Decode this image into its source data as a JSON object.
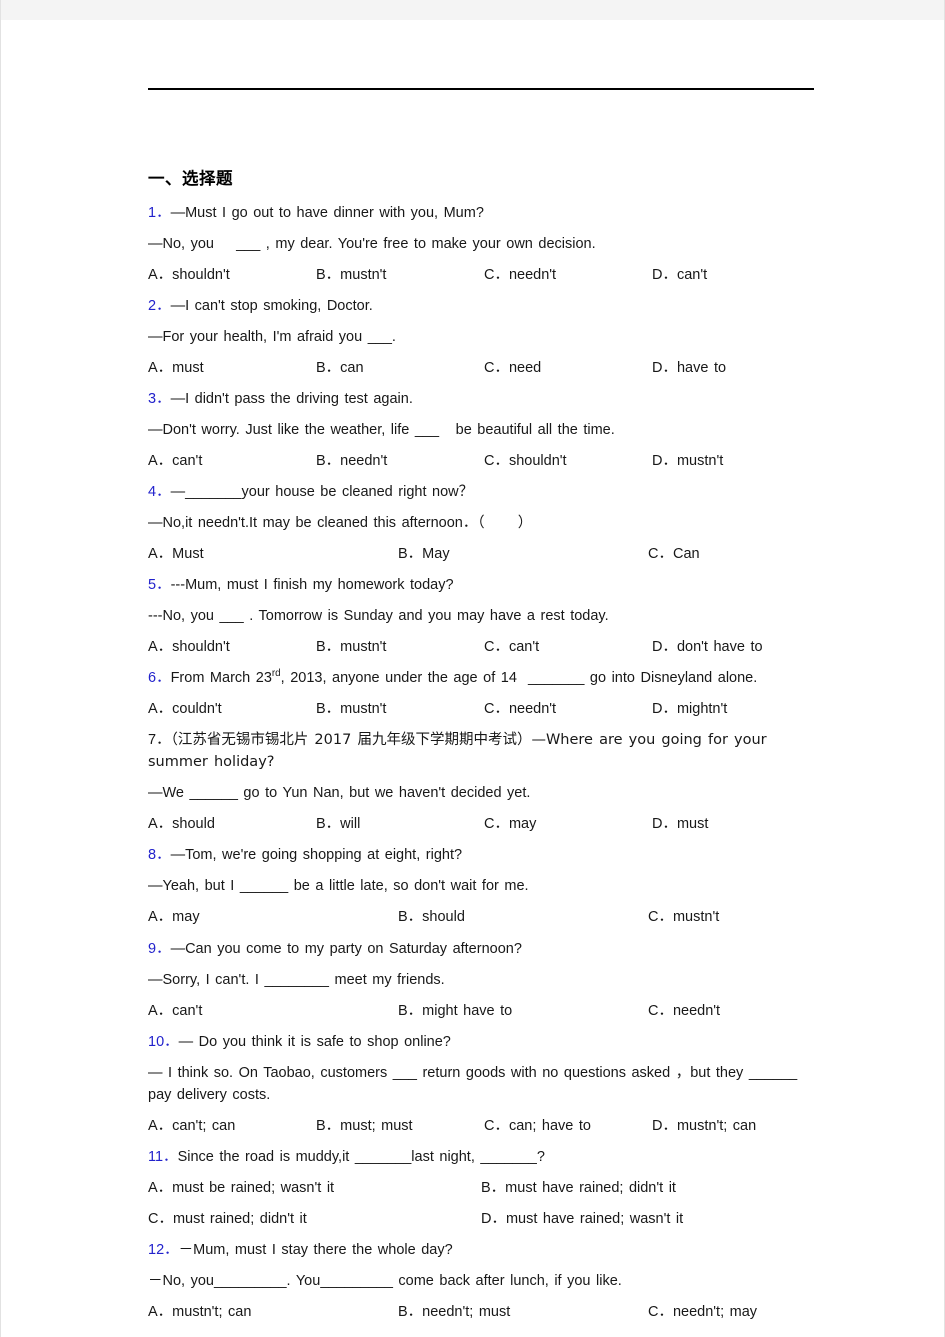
{
  "document": {
    "section_heading": "一、选择题",
    "questions": [
      {
        "number": "1．",
        "lines": [
          "—Must I go out to have dinner with you, Mum?",
          "—No, you    ___ , my dear. You're free to make your own decision."
        ],
        "options": [
          "A．shouldn't",
          "B．mustn't",
          "C．needn't",
          "D．can't"
        ],
        "option_cols": 4
      },
      {
        "number": "2．",
        "lines": [
          "—I can't stop smoking, Doctor.",
          "—For your health, I'm afraid you ___."
        ],
        "options": [
          "A．must",
          "B．can",
          "C．need",
          "D．have to"
        ],
        "option_cols": 4
      },
      {
        "number": "3．",
        "lines": [
          "—I didn't pass the driving test again.",
          "—Don't worry. Just like the weather, life ___   be beautiful all the time."
        ],
        "options": [
          "A．can't",
          "B．needn't",
          "C．shouldn't",
          "D．mustn't"
        ],
        "option_cols": 4
      },
      {
        "number": "4．",
        "lines": [
          "—_______your house be cleaned right now？",
          "—No,it needn't.It may be cleaned this afternoon．（      ）"
        ],
        "options": [
          "A．Must",
          "B．May",
          "C．Can"
        ],
        "option_cols": 3
      },
      {
        "number": "5．",
        "lines": [
          "---Mum, must I finish my homework today?",
          "---No, you ___ . Tomorrow is Sunday and you may have a rest today."
        ],
        "options": [
          "A．shouldn't",
          "B．mustn't",
          "C．can't",
          "D．don't have to"
        ],
        "option_cols": 4
      },
      {
        "number": "6．",
        "lines": [
          "From March 23rd, 2013, anyone under the age of 14  _______ go into Disneyland alone."
        ],
        "superscript_line": true,
        "options": [
          "A．couldn't",
          "B．mustn't",
          "C．needn't",
          "D．mightn't"
        ],
        "option_cols": 4
      },
      {
        "number": "7．",
        "lines": [
          "（江苏省无锡市锡北片 2017 届九年级下学期期中考试）—Where are you going for your summer holiday?",
          "—We ______ go to Yun Nan, but we haven't decided yet."
        ],
        "options": [
          "A．should",
          "B．will",
          "C．may",
          "D．must"
        ],
        "option_cols": 4
      },
      {
        "number": "8．",
        "lines": [
          "—Tom, we're going shopping at eight, right?",
          "—Yeah, but I ______ be a little late, so don't wait for me."
        ],
        "options": [
          "A．may",
          "B．should",
          "C．mustn't"
        ],
        "option_cols": 3
      },
      {
        "number": "9．",
        "lines": [
          "—Can you come to my party on Saturday afternoon?",
          "—Sorry, I can't. I ________ meet my friends."
        ],
        "options": [
          "A．can't",
          "B．might have to",
          "C．needn't"
        ],
        "option_cols": 3
      },
      {
        "number": "10．",
        "lines": [
          "— Do you think it is safe to shop online?",
          "— I think so. On Taobao, customers ___  return goods with no questions asked ，but they ______ pay delivery costs."
        ],
        "options": [
          "A．can't; can",
          "B．must; must",
          "C．can; have to",
          "D．mustn't; can"
        ],
        "option_cols": 4
      },
      {
        "number": "11．",
        "lines": [
          "Since the road is muddy,it _______last night, _______?"
        ],
        "options": [
          "A．must be rained; wasn't it",
          "B．must have rained; didn't it",
          "C．must rained; didn't it",
          "D．must have rained; wasn't it"
        ],
        "option_cols": 2
      },
      {
        "number": "12．",
        "lines": [
          "－Mum, must I stay there the whole day?",
          "－No, you_________. You_________ come back after lunch, if you like."
        ],
        "options": [
          "A．mustn't; can",
          "B．needn't; must",
          "C．needn't; may"
        ],
        "option_cols": 3
      }
    ]
  },
  "colors": {
    "question_number": "#2222CC",
    "body_text": "#181818",
    "rule": "#000000",
    "page_background": "#ffffff",
    "canvas_background": "#f4f4f4"
  }
}
